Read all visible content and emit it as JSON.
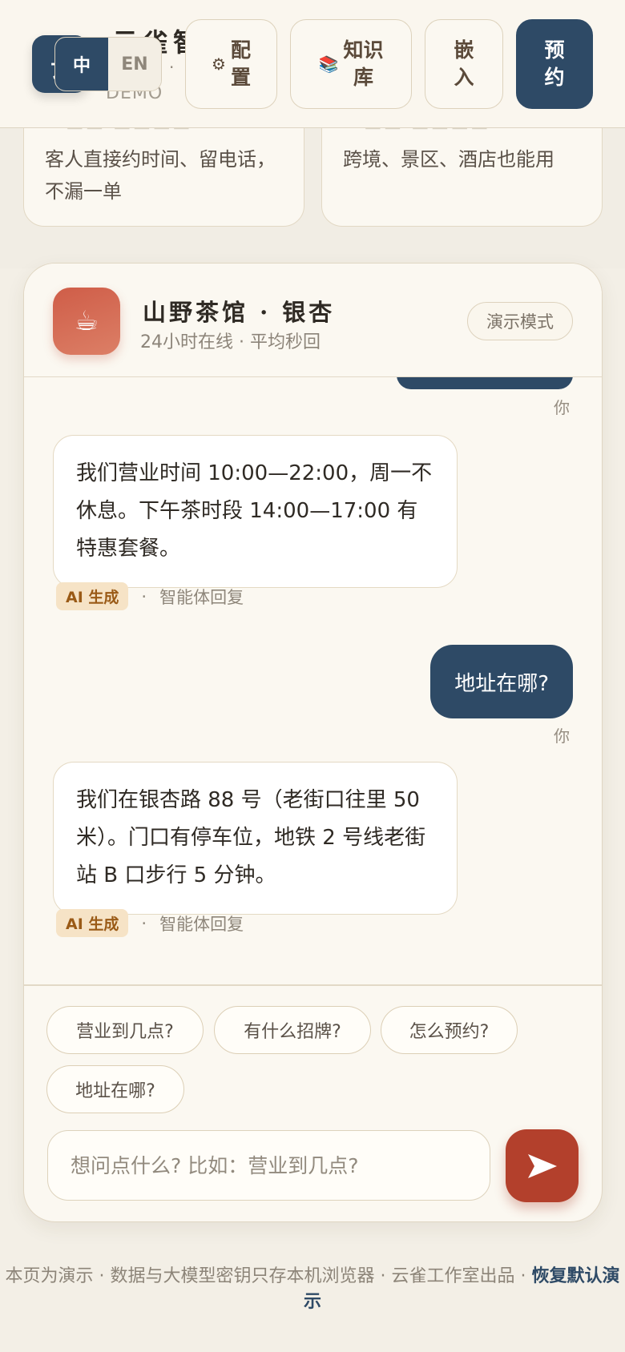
{
  "header": {
    "brand_logo_glyph": "云",
    "brand_name": "云雀智",
    "brand_dot": "·",
    "brand_sub": "DEMO",
    "lang_options": [
      "中",
      "EN"
    ],
    "nav": {
      "config_icon": "gear-icon",
      "config_label_1": "配",
      "config_label_2": "置",
      "kb_icon": "books-icon",
      "kb_label_1": "知识",
      "kb_label_2": "库",
      "embed_label_1": "嵌",
      "embed_label_2": "入",
      "book_label_1": "预",
      "book_label_2": "约"
    }
  },
  "features": [
    {
      "desc": "客人直接约时间、留电话，不漏一单"
    },
    {
      "desc": "跨境、景区、酒店也能用"
    }
  ],
  "chat": {
    "shop_avatar": "☕",
    "shop_name": "山野茶馆 · 银杏",
    "shop_status": "24小时在线 · 平均秒回",
    "demo_label": "演示模式",
    "you_label": "你",
    "messages": [
      {
        "role": "ai",
        "text": "我们营业时间 10:00—22:00，周一不休息。下午茶时段 14:00—17:00 有特惠套餐。",
        "badge": "AI 生成",
        "source": "智能体回复"
      },
      {
        "role": "user",
        "text": "地址在哪?"
      },
      {
        "role": "ai",
        "text": "我们在银杏路 88 号（老街口往里 50 米）。门口有停车位，地铁 2 号线老街站 B 口步行 5 分钟。",
        "badge": "AI 生成",
        "source": "智能体回复"
      }
    ],
    "meta_sep": "·",
    "quick_replies": [
      "营业到几点?",
      "有什么招牌?",
      "怎么预约?",
      "地址在哪?"
    ],
    "input_placeholder": "想问点什么? 比如：营业到几点?",
    "send_icon": "send-arrow-icon"
  },
  "footer": {
    "text": "本页为演示 · 数据与大模型密钥只存本机浏览器 · 云雀工作室出品 · ",
    "restore_link": "恢复默认演示"
  },
  "colors": {
    "primary": "#2e4a66",
    "accent": "#b3402c",
    "background": "#f3efe6",
    "card": "#fbf8f1"
  }
}
